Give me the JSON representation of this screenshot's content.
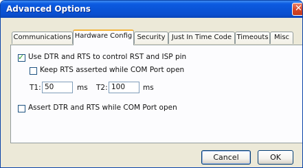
{
  "window": {
    "title": "Advanced Options",
    "close_symbol": "✕"
  },
  "tabs": [
    {
      "label": "Communications",
      "active": false
    },
    {
      "label": "Hardware Config",
      "active": true
    },
    {
      "label": "Security",
      "active": false
    },
    {
      "label": "Just In Time Code",
      "active": false
    },
    {
      "label": "Timeouts",
      "active": false
    },
    {
      "label": "Misc",
      "active": false
    }
  ],
  "hardware_config": {
    "use_dtr_rts": {
      "label": "Use DTR and RTS to control RST and ISP pin",
      "checked": true
    },
    "keep_rts": {
      "label": "Keep RTS asserted while COM Port open",
      "checked": false
    },
    "t1": {
      "label": "T1:",
      "value": "50",
      "unit": "ms"
    },
    "t2": {
      "label": "T2:",
      "value": "100",
      "unit": "ms"
    },
    "assert_dtr_rts": {
      "label": "Assert DTR and RTS while COM Port open",
      "checked": false
    }
  },
  "buttons": {
    "cancel": "Cancel",
    "ok": "OK"
  },
  "colors": {
    "titlebar": "#0a53d6",
    "tab_highlight": "#f3b33a",
    "check": "#21a121",
    "window_bg": "#ece9d8"
  }
}
